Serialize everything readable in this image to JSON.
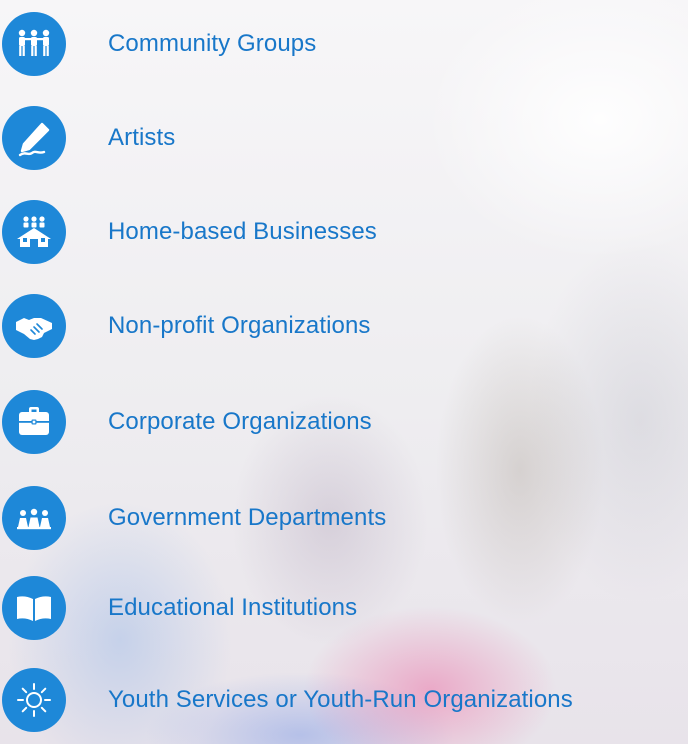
{
  "items": [
    {
      "label": "Community Groups",
      "icon": "people-group-icon"
    },
    {
      "label": "Artists",
      "icon": "pen-icon"
    },
    {
      "label": "Home-based Businesses",
      "icon": "home-people-icon"
    },
    {
      "label": "Non-profit Organizations",
      "icon": "handshake-icon"
    },
    {
      "label": "Corporate Organizations",
      "icon": "briefcase-icon"
    },
    {
      "label": "Government Departments",
      "icon": "officials-icon"
    },
    {
      "label": "Educational Institutions",
      "icon": "book-icon"
    },
    {
      "label": "Youth Services or Youth-Run Organizations",
      "icon": "sun-icon"
    }
  ],
  "colors": {
    "accent": "#1e88d8",
    "label_text": "#1877c9"
  }
}
